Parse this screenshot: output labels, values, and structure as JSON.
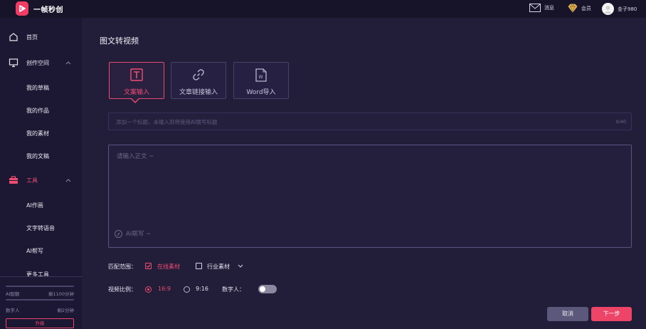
{
  "brand": {
    "name": "一帧秒创",
    "accent": "#ef4d72"
  },
  "topbar": {
    "messages": {
      "icon": "mail-icon",
      "label": "消息"
    },
    "vip": {
      "icon": "diamond-icon",
      "label": "会员"
    },
    "user": {
      "icon": "avatar",
      "label": "金子980"
    }
  },
  "sidebar": {
    "home": "首页",
    "creative_space": "创作空间",
    "my_drafts": "我的草稿",
    "my_works": "我的作品",
    "my_materials": "我的素材",
    "my_docs": "我的文稿",
    "tools": "工具",
    "ai_painting": "AI作画",
    "text_to_speech": "文字转语音",
    "ai_writing": "AI帮写",
    "more_tools": "更多工具",
    "quota_ai_label": "AI配额",
    "quota_ai_value": "剩1100分钟",
    "quota_dh_label": "数字人",
    "quota_dh_value": "剩2分钟",
    "upgrade": "升级"
  },
  "main": {
    "title": "图文转视频",
    "tabs": [
      {
        "label": "文案输入",
        "icon": "text-icon"
      },
      {
        "label": "文章链接输入",
        "icon": "link-icon"
      },
      {
        "label": "Word导入",
        "icon": "word-doc-icon"
      }
    ],
    "title_input": {
      "placeholder": "添加一个标题，未输入则将使用AI撰写标题",
      "counter": "0/40"
    },
    "body_input": {
      "placeholder": "请输入正文 ~",
      "ai_label": "AI帮写 ~"
    },
    "match_scope": {
      "label": "匹配范围：",
      "online": "在线素材",
      "industry": "行业素材"
    },
    "aspect": {
      "label": "视频比例：",
      "opt1": "16:9",
      "opt2": "9:16"
    },
    "digital_human_label": "数字人：",
    "cancel": "取消",
    "next": "下一步"
  }
}
